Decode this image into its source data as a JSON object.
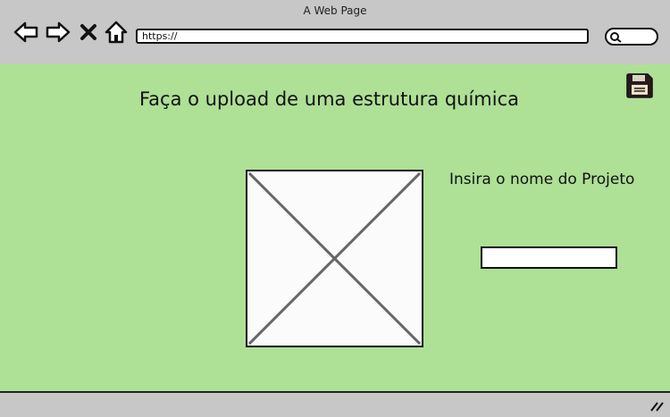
{
  "window": {
    "title": "A Web Page"
  },
  "toolbar": {
    "url": "https://",
    "icons": [
      "back-arrow-icon",
      "forward-arrow-icon",
      "close-x-icon",
      "home-icon",
      "search-icon"
    ]
  },
  "main": {
    "heading": "Faça o upload de uma estrutura química",
    "project_label": "Insira o nome do Projeto",
    "project_input_value": "",
    "save_icon": "floppy-disk-icon",
    "image_placeholder": "image-placeholder-icon"
  },
  "colors": {
    "content_bg": "#aee096",
    "chrome_bg": "#c7c7c7",
    "outline": "#111111"
  }
}
